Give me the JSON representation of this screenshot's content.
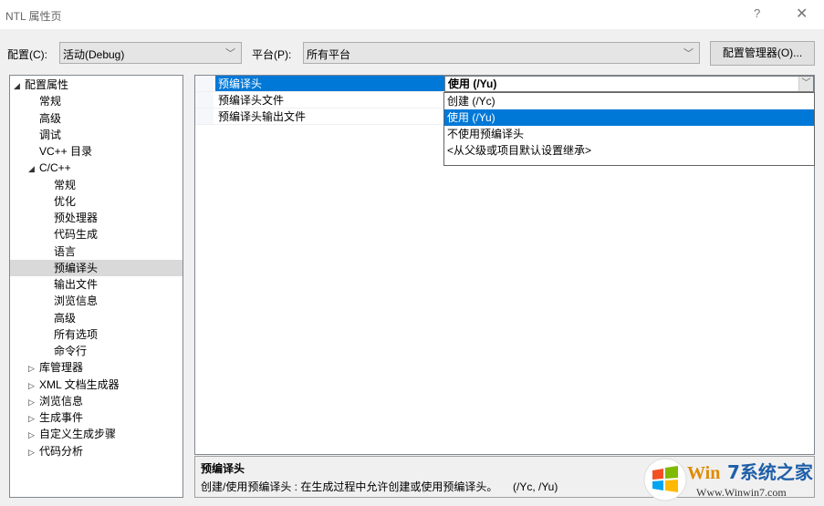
{
  "window": {
    "title": "NTL 属性页",
    "help": "?",
    "close": "✕"
  },
  "toolbar": {
    "config_label": "配置(C):",
    "config_value": "活动(Debug)",
    "platform_label": "平台(P):",
    "platform_value": "所有平台",
    "config_manager": "配置管理器(O)..."
  },
  "tree": [
    {
      "label": "配置属性",
      "arrow": "◢",
      "level": 0
    },
    {
      "label": "常规",
      "arrow": "",
      "level": 1
    },
    {
      "label": "高级",
      "arrow": "",
      "level": 1
    },
    {
      "label": "调试",
      "arrow": "",
      "level": 1
    },
    {
      "label": "VC++ 目录",
      "arrow": "",
      "level": 1
    },
    {
      "label": "C/C++",
      "arrow": "◢",
      "level": 1
    },
    {
      "label": "常规",
      "arrow": "",
      "level": 2
    },
    {
      "label": "优化",
      "arrow": "",
      "level": 2
    },
    {
      "label": "预处理器",
      "arrow": "",
      "level": 2
    },
    {
      "label": "代码生成",
      "arrow": "",
      "level": 2
    },
    {
      "label": "语言",
      "arrow": "",
      "level": 2
    },
    {
      "label": "预编译头",
      "arrow": "",
      "level": 2,
      "selected": true
    },
    {
      "label": "输出文件",
      "arrow": "",
      "level": 2
    },
    {
      "label": "浏览信息",
      "arrow": "",
      "level": 2
    },
    {
      "label": "高级",
      "arrow": "",
      "level": 2
    },
    {
      "label": "所有选项",
      "arrow": "",
      "level": 2
    },
    {
      "label": "命令行",
      "arrow": "",
      "level": 2
    },
    {
      "label": "库管理器",
      "arrow": "▷",
      "level": 1
    },
    {
      "label": "XML 文档生成器",
      "arrow": "▷",
      "level": 1
    },
    {
      "label": "浏览信息",
      "arrow": "▷",
      "level": 1
    },
    {
      "label": "生成事件",
      "arrow": "▷",
      "level": 1
    },
    {
      "label": "自定义生成步骤",
      "arrow": "▷",
      "level": 1
    },
    {
      "label": "代码分析",
      "arrow": "▷",
      "level": 1
    }
  ],
  "grid": {
    "rows": [
      "预编译头",
      "预编译头文件",
      "预编译头输出文件"
    ],
    "value": "使用 (/Yu)"
  },
  "dropdown": {
    "options": [
      "创建 (/Yc)",
      "使用 (/Yu)",
      "不使用预编译头",
      "<从父级或项目默认设置继承>"
    ],
    "selected": 1
  },
  "description": {
    "title": "预编译头",
    "text": "创建/使用预编译头 : 在生成过程中允许创建或使用预编译头。     (/Yc, /Yu)"
  },
  "watermark": {
    "brand": "Win7系统之家",
    "url": "Www.Winwin7.com"
  },
  "colors": {
    "accent": "#0078d7"
  }
}
